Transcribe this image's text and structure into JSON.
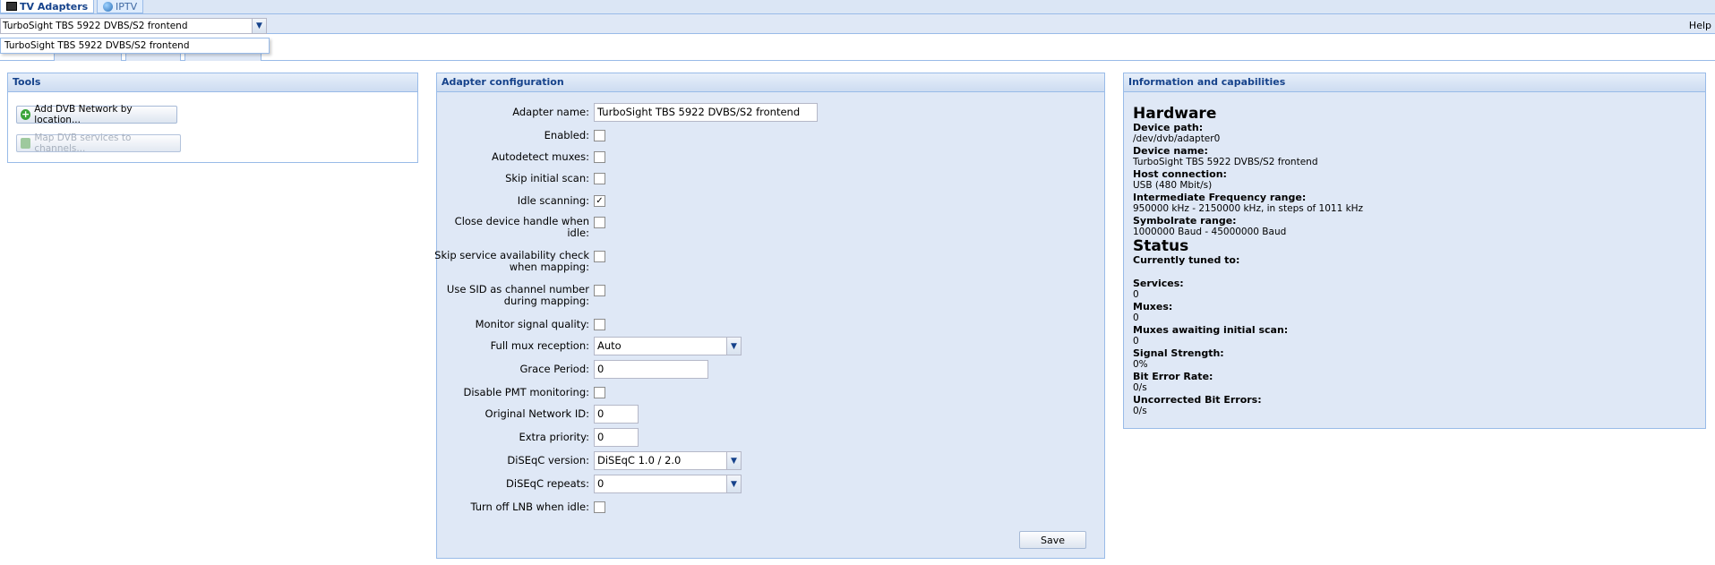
{
  "tabs": [
    {
      "label": "TV Adapters",
      "icon": "tv-icon",
      "active": true
    },
    {
      "label": "IPTV",
      "icon": "globe-icon",
      "active": false
    }
  ],
  "toolbar": {
    "adapter_selected": "TurboSight TBS 5922 DVBS/S2 frontend",
    "dropdown_option": "TurboSight TBS 5922 DVBS/S2 frontend",
    "help_label": "Help"
  },
  "tools": {
    "title": "Tools",
    "add_network_label": "Add DVB Network by location...",
    "map_services_label": "Map DVB services to channels..."
  },
  "config": {
    "title": "Adapter configuration",
    "adapter_name_label": "Adapter name:",
    "adapter_name_value": "TurboSight TBS 5922 DVBS/S2 frontend",
    "enabled_label": "Enabled:",
    "autodetect_label": "Autodetect muxes:",
    "skip_initial_label": "Skip initial scan:",
    "idle_scanning_label": "Idle scanning:",
    "close_handle_label_1": "Close device handle when",
    "close_handle_label_2": "idle:",
    "skip_service_label_1": "Skip service availability check",
    "skip_service_label_2": "when mapping:",
    "use_sid_label_1": "Use SID as channel number",
    "use_sid_label_2": "during mapping:",
    "monitor_signal_label": "Monitor signal quality:",
    "full_mux_label": "Full mux reception:",
    "full_mux_value": "Auto",
    "grace_period_label": "Grace Period:",
    "grace_period_value": "0",
    "disable_pmt_label": "Disable PMT monitoring:",
    "original_network_label": "Original Network ID:",
    "original_network_value": "0",
    "extra_priority_label": "Extra priority:",
    "extra_priority_value": "0",
    "diseqc_version_label": "DiSEqC version:",
    "diseqc_version_value": "DiSEqC 1.0 / 2.0",
    "diseqc_repeats_label": "DiSEqC repeats:",
    "diseqc_repeats_value": "0",
    "turn_off_lnb_label": "Turn off LNB when idle:",
    "save_label": "Save",
    "checkmark": "✓"
  },
  "info": {
    "title": "Information and capabilities",
    "hardware_heading": "Hardware",
    "device_path_label": "Device path:",
    "device_path_value": "/dev/dvb/adapter0",
    "device_name_label": "Device name:",
    "device_name_value": "TurboSight TBS 5922 DVBS/S2 frontend",
    "host_connection_label": "Host connection:",
    "host_connection_value": "USB (480 Mbit/s)",
    "if_range_label": "Intermediate Frequency range:",
    "if_range_value": "950000 kHz - 2150000 kHz, in steps of 1011 kHz",
    "symbolrate_label": "Symbolrate range:",
    "symbolrate_value": "1000000 Baud - 45000000 Baud",
    "status_heading": "Status",
    "tuned_label": "Currently tuned to:",
    "services_label": "Services:",
    "services_value": "0",
    "muxes_label": "Muxes:",
    "muxes_value": "0",
    "awaiting_label": "Muxes awaiting initial scan:",
    "awaiting_value": "0",
    "signal_label": "Signal Strength:",
    "signal_value": "0%",
    "ber_label": "Bit Error Rate:",
    "ber_value": "0/s",
    "uncorrected_label": "Uncorrected Bit Errors:",
    "uncorrected_value": "0/s"
  }
}
